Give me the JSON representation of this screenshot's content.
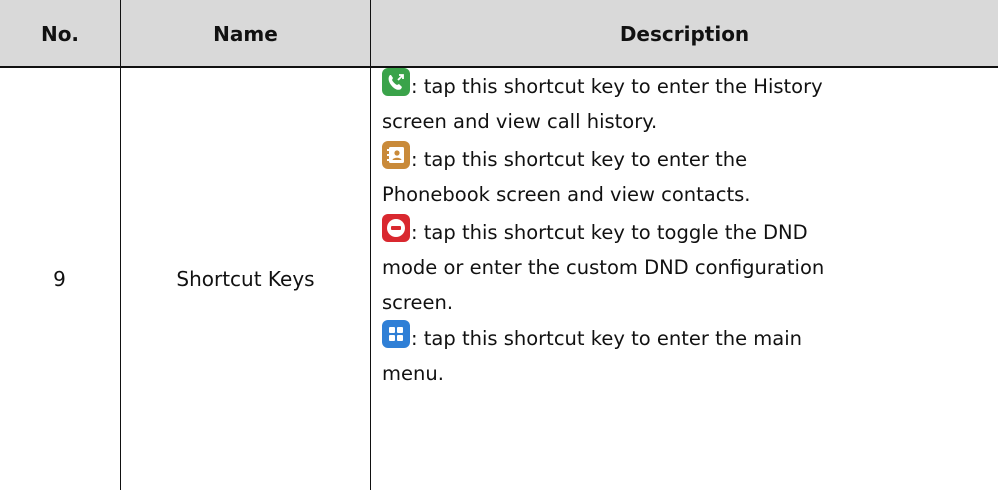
{
  "table": {
    "headers": {
      "no": "No.",
      "name": "Name",
      "description": "Description"
    },
    "row": {
      "no": "9",
      "name": "Shortcut Keys",
      "items": [
        {
          "icon": "history-icon",
          "color": "#3aa34a",
          "line1": ": tap this shortcut key to enter the History",
          "line2": "screen and view call history."
        },
        {
          "icon": "phonebook-icon",
          "color": "#c98a3a",
          "line1": ": tap this shortcut key to enter the",
          "line2": "Phonebook screen and view contacts."
        },
        {
          "icon": "dnd-icon",
          "color": "#d9282f",
          "line1": ": tap this shortcut key to toggle the DND",
          "line2": "mode or enter the custom DND configuration",
          "line3": "screen."
        },
        {
          "icon": "menu-icon",
          "color": "#2f7fd6",
          "line1": ": tap this shortcut key to enter the main",
          "line2": "menu."
        }
      ]
    }
  }
}
